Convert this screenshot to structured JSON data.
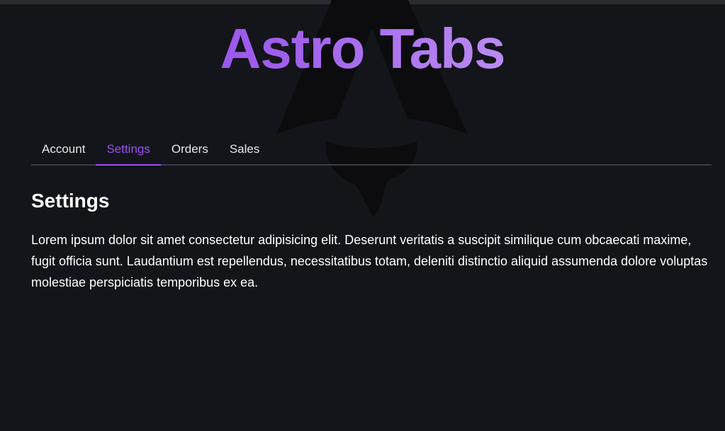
{
  "page": {
    "title": "Astro Tabs"
  },
  "tabs": [
    {
      "label": "Account",
      "active": false
    },
    {
      "label": "Settings",
      "active": true
    },
    {
      "label": "Orders",
      "active": false
    },
    {
      "label": "Sales",
      "active": false
    }
  ],
  "panel": {
    "heading": "Settings",
    "body": "Lorem ipsum dolor sit amet consectetur adipisicing elit. Deserunt veritatis a suscipit similique cum obcaecati maxime, fugit officia sunt. Laudantium est repellendus, necessitatibus totam, deleniti distinctio aliquid assumenda dolore voluptas molestiae perspiciatis temporibus ex ea."
  },
  "colors": {
    "background": "#14151b",
    "accent": "#9b4ff5",
    "tab_divider": "#3a3c48",
    "text": "#ffffff"
  },
  "icons": {
    "background_logo": "astro-logo-icon"
  }
}
